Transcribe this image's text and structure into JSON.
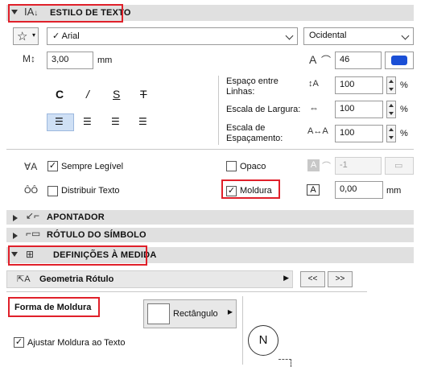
{
  "sections": {
    "text_style": "ESTILO DE TEXTO",
    "pointer": "APONTADOR",
    "symbol_label": "RÓTULO DO SÍMBOLO",
    "custom_settings": "DEFINIÇÕES À MEDIDA"
  },
  "font": {
    "name": "Arial",
    "script": "Ocidental",
    "size": "3,00",
    "size_unit": "mm",
    "pen": "46"
  },
  "style_buttons": {
    "bold": "C",
    "italic": "/",
    "underline": "S",
    "strike": "T"
  },
  "spacing": {
    "line_label": "Espaço entre Linhas:",
    "line_value": "100",
    "width_label": "Escala de Largura:",
    "width_value": "100",
    "char_label": "Escala de Espaçamento:",
    "char_value": "100",
    "percent": "%"
  },
  "options": {
    "always_readable": "Sempre Legível",
    "distribute": "Distribuir Texto",
    "opaque": "Opaco",
    "frame": "Moldura",
    "bg_pen": "-1",
    "frame_offset": "0,00",
    "frame_offset_unit": "mm"
  },
  "custom": {
    "dropdown": "Geometria Rótulo",
    "prev": "<<",
    "next": ">>",
    "frame_shape_label": "Forma de Moldura",
    "frame_shape_value": "Rectângulo",
    "fit_frame": "Ajustar Moldura ao Texto",
    "preview_letter": "N"
  },
  "colors": {
    "accent": "#1a4fd6",
    "highlight": "#e0202a"
  }
}
